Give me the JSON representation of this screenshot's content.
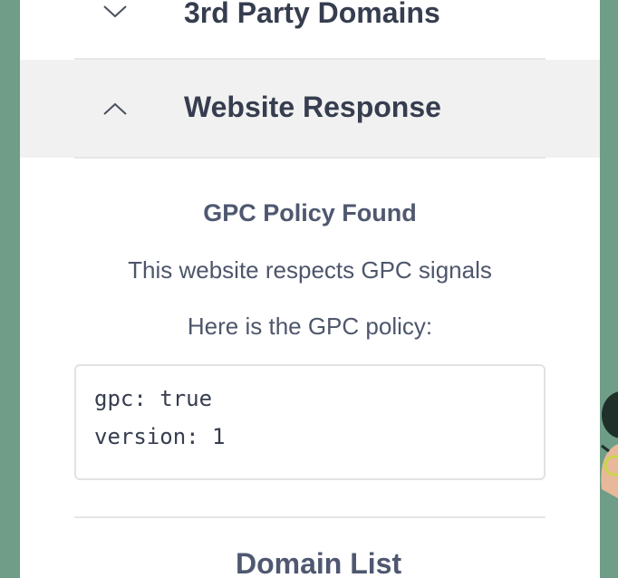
{
  "sections": {
    "third_party": {
      "title": "3rd Party Domains",
      "icon": "chevron-down-icon"
    },
    "website_response": {
      "title": "Website Response",
      "icon": "chevron-up-icon"
    }
  },
  "response": {
    "heading": "GPC Policy Found",
    "message": "This website respects GPC signals",
    "intro": "Here is the GPC policy:",
    "policy_lines": [
      "gpc: true",
      "version: 1"
    ]
  },
  "domain_list": {
    "title": "Domain List"
  },
  "colors": {
    "background": "#6f9d87",
    "panel": "#ffffff",
    "header_active": "#f1f1f1",
    "heading_text": "#363d4f",
    "body_text": "#4d566b"
  }
}
